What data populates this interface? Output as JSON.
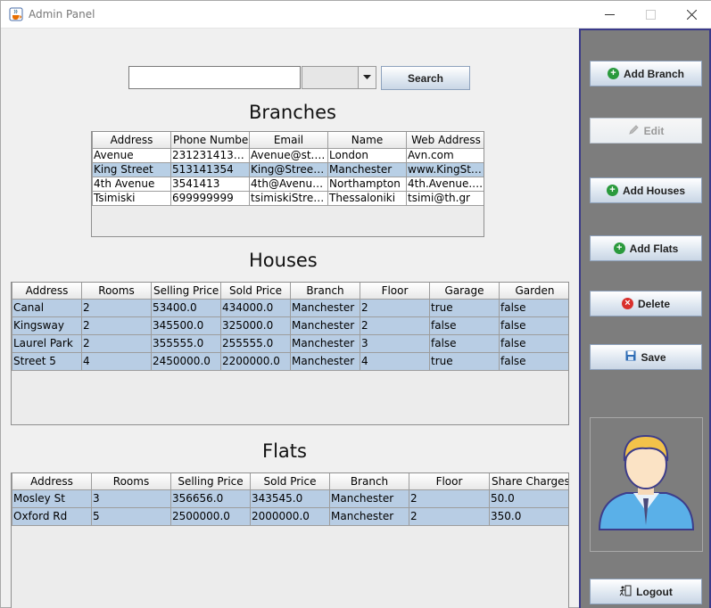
{
  "window": {
    "title": "Admin Panel"
  },
  "search": {
    "value": "",
    "combo_value": "",
    "button_label": "Search"
  },
  "branches": {
    "title": "Branches",
    "columns": [
      "Address",
      "Phone Number",
      "Email",
      "Name",
      "Web Address"
    ],
    "rows": [
      [
        "Avenue",
        "2312314134...",
        "Avenue@st.c...",
        "London",
        "Avn.com"
      ],
      [
        "King Street",
        "513141354",
        "King@Street....",
        "Manchester",
        "www.KingStr..."
      ],
      [
        "4th Avenue",
        "3541413",
        "4th@Avenue.uk",
        "Northampton",
        "4th.Avenue.uk"
      ],
      [
        "Tsimiski",
        "699999999",
        "tsimiskiStreet...",
        "Thessaloniki",
        "tsimi@th.gr"
      ]
    ]
  },
  "houses": {
    "title": "Houses",
    "columns": [
      "Address",
      "Rooms",
      "Selling Price",
      "Sold Price",
      "Branch",
      "Floor",
      "Garage",
      "Garden"
    ],
    "rows": [
      [
        "Canal",
        "2",
        "53400.0",
        "434000.0",
        "Manchester",
        "2",
        "true",
        "false"
      ],
      [
        "Kingsway",
        "2",
        "345500.0",
        "325000.0",
        "Manchester",
        "2",
        "false",
        "false"
      ],
      [
        "Laurel Park",
        "2",
        "355555.0",
        "255555.0",
        "Manchester",
        "3",
        "false",
        "false"
      ],
      [
        "Street 5",
        "4",
        "2450000.0",
        "2200000.0",
        "Manchester",
        "4",
        "true",
        "false"
      ]
    ]
  },
  "flats": {
    "title": "Flats",
    "columns": [
      "Address",
      "Rooms",
      "Selling Price",
      "Sold Price",
      "Branch",
      "Floor",
      "Share Charges"
    ],
    "rows": [
      [
        "Mosley St",
        "3",
        "356656.0",
        "343545.0",
        "Manchester",
        "2",
        "50.0"
      ],
      [
        "Oxford Rd",
        "5",
        "2500000.0",
        "2000000.0",
        "Manchester",
        "2",
        "350.0"
      ]
    ]
  },
  "sidebar": {
    "add_branch": "Add Branch",
    "edit": "Edit",
    "add_houses": "Add Houses",
    "add_flats": "Add Flats",
    "delete": "Delete",
    "save": "Save",
    "logout": "Logout"
  },
  "icons": {
    "app": "java-cup-icon",
    "add": "plus-circle-icon",
    "edit": "pencil-icon",
    "delete": "x-circle-icon",
    "save": "floppy-disk-icon",
    "logout": "exit-door-icon",
    "avatar": "user-avatar-icon"
  },
  "colors": {
    "sidebar_bg": "#7d7d7d",
    "sidebar_border": "#3a3a8a",
    "row_selected": "#b8cfe5",
    "add_icon": "#2a9a3d",
    "delete_icon": "#d9302c"
  }
}
